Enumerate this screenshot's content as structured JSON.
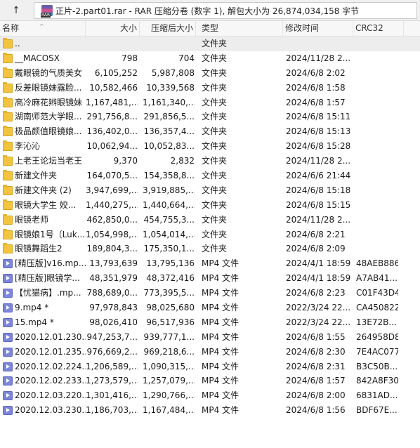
{
  "address": {
    "up_glyph": "↑",
    "text": "正片-2.part01.rar - RAR 压缩分卷 (数字 1), 解包大小为 26,874,034,158 字节"
  },
  "columns": {
    "name": "名称",
    "size": "大小",
    "packed": "压缩后大小",
    "type": "类型",
    "modified": "修改时间",
    "crc": "CRC32"
  },
  "rows": [
    {
      "icon": "folder",
      "name": "..",
      "size": "",
      "packed": "",
      "type": "文件夹",
      "modified": "",
      "crc": "",
      "selected": true
    },
    {
      "icon": "folder",
      "name": "__MACOSX",
      "size": "798",
      "packed": "704",
      "type": "文件夹",
      "modified": "2024/11/28 2...",
      "crc": ""
    },
    {
      "icon": "folder",
      "name": "戴眼镜的气质美女",
      "size": "6,105,252",
      "packed": "5,987,808",
      "type": "文件夹",
      "modified": "2024/6/8 2:02",
      "crc": ""
    },
    {
      "icon": "folder",
      "name": "反差眼镜妹露脸...",
      "size": "10,582,466",
      "packed": "10,339,568",
      "type": "文件夹",
      "modified": "2024/6/8 1:58",
      "crc": ""
    },
    {
      "icon": "folder",
      "name": "高冷麻花辫眼镜妹",
      "size": "1,167,481,...",
      "packed": "1,161,340,...",
      "type": "文件夹",
      "modified": "2024/6/8 1:57",
      "crc": ""
    },
    {
      "icon": "folder",
      "name": "湖南师范大学眼...",
      "size": "291,756,8...",
      "packed": "291,856,5...",
      "type": "文件夹",
      "modified": "2024/6/8 15:11",
      "crc": ""
    },
    {
      "icon": "folder",
      "name": "极品颜值眼镜娘...",
      "size": "136,402,0...",
      "packed": "136,357,4...",
      "type": "文件夹",
      "modified": "2024/6/8 15:13",
      "crc": ""
    },
    {
      "icon": "folder",
      "name": "李沁沁",
      "size": "10,062,94...",
      "packed": "10,052,83...",
      "type": "文件夹",
      "modified": "2024/6/8 15:28",
      "crc": ""
    },
    {
      "icon": "folder",
      "name": "上老王论坛当老王",
      "size": "9,370",
      "packed": "2,832",
      "type": "文件夹",
      "modified": "2024/11/28 2...",
      "crc": ""
    },
    {
      "icon": "folder",
      "name": "新建文件夹",
      "size": "164,070,5...",
      "packed": "154,358,8...",
      "type": "文件夹",
      "modified": "2024/6/6 21:44",
      "crc": ""
    },
    {
      "icon": "folder",
      "name": "新建文件夹 (2)",
      "size": "3,947,699,...",
      "packed": "3,919,885,...",
      "type": "文件夹",
      "modified": "2024/6/8 15:18",
      "crc": ""
    },
    {
      "icon": "folder",
      "name": "眼镜大学生 姣...",
      "size": "1,440,275,...",
      "packed": "1,440,664,...",
      "type": "文件夹",
      "modified": "2024/6/8 15:15",
      "crc": ""
    },
    {
      "icon": "folder",
      "name": "眼镜老师",
      "size": "462,850,0...",
      "packed": "454,755,3...",
      "type": "文件夹",
      "modified": "2024/11/28 2...",
      "crc": ""
    },
    {
      "icon": "folder",
      "name": "眼镜娘1号（Luk...",
      "size": "1,054,998,...",
      "packed": "1,054,014,...",
      "type": "文件夹",
      "modified": "2024/6/8 2:21",
      "crc": ""
    },
    {
      "icon": "folder",
      "name": "眼镜舞蹈生2",
      "size": "189,804,3...",
      "packed": "175,350,1...",
      "type": "文件夹",
      "modified": "2024/6/8 2:09",
      "crc": ""
    },
    {
      "icon": "video",
      "name": "[精压版]v16.mp...",
      "size": "13,793,639",
      "packed": "13,795,136",
      "type": "MP4 文件",
      "modified": "2024/4/1 18:59",
      "crc": "48AEB886"
    },
    {
      "icon": "video",
      "name": "[精压版]眼镜学...",
      "size": "48,351,979",
      "packed": "48,372,416",
      "type": "MP4 文件",
      "modified": "2024/4/1 18:59",
      "crc": "A7AB41..."
    },
    {
      "icon": "video",
      "name": "【忧猫病】.mp...",
      "size": "788,689,0...",
      "packed": "773,395,5...",
      "type": "MP4 文件",
      "modified": "2024/6/8 2:23",
      "crc": "C01F43D4"
    },
    {
      "icon": "video",
      "name": "9.mp4 *",
      "size": "97,978,843",
      "packed": "98,025,680",
      "type": "MP4 文件",
      "modified": "2022/3/24 22...",
      "crc": "CA450822"
    },
    {
      "icon": "video",
      "name": "15.mp4 *",
      "size": "98,026,410",
      "packed": "96,517,936",
      "type": "MP4 文件",
      "modified": "2022/3/24 22...",
      "crc": "13E72B..."
    },
    {
      "icon": "video",
      "name": "2020.12.01.230...",
      "size": "947,253,7...",
      "packed": "939,777,1...",
      "type": "MP4 文件",
      "modified": "2024/6/8 1:55",
      "crc": "264958D8"
    },
    {
      "icon": "video",
      "name": "2020.12.01.235...",
      "size": "976,669,2...",
      "packed": "969,218,6...",
      "type": "MP4 文件",
      "modified": "2024/6/8 2:30",
      "crc": "7E4AC077"
    },
    {
      "icon": "video",
      "name": "2020.12.02.224...",
      "size": "1,206,589,...",
      "packed": "1,090,315,...",
      "type": "MP4 文件",
      "modified": "2024/6/8 2:31",
      "crc": "B3C50B..."
    },
    {
      "icon": "video",
      "name": "2020.12.02.233...",
      "size": "1,273,579,...",
      "packed": "1,257,079,...",
      "type": "MP4 文件",
      "modified": "2024/6/8 1:57",
      "crc": "842A8F30"
    },
    {
      "icon": "video",
      "name": "2020.12.03.220...",
      "size": "1,301,416,...",
      "packed": "1,290,766,...",
      "type": "MP4 文件",
      "modified": "2024/6/8 2:00",
      "crc": "6831AD..."
    },
    {
      "icon": "video",
      "name": "2020.12.03.230...",
      "size": "1,186,703,...",
      "packed": "1,167,484,...",
      "type": "MP4 文件",
      "modified": "2024/6/8 1:56",
      "crc": "BDF67E..."
    }
  ]
}
